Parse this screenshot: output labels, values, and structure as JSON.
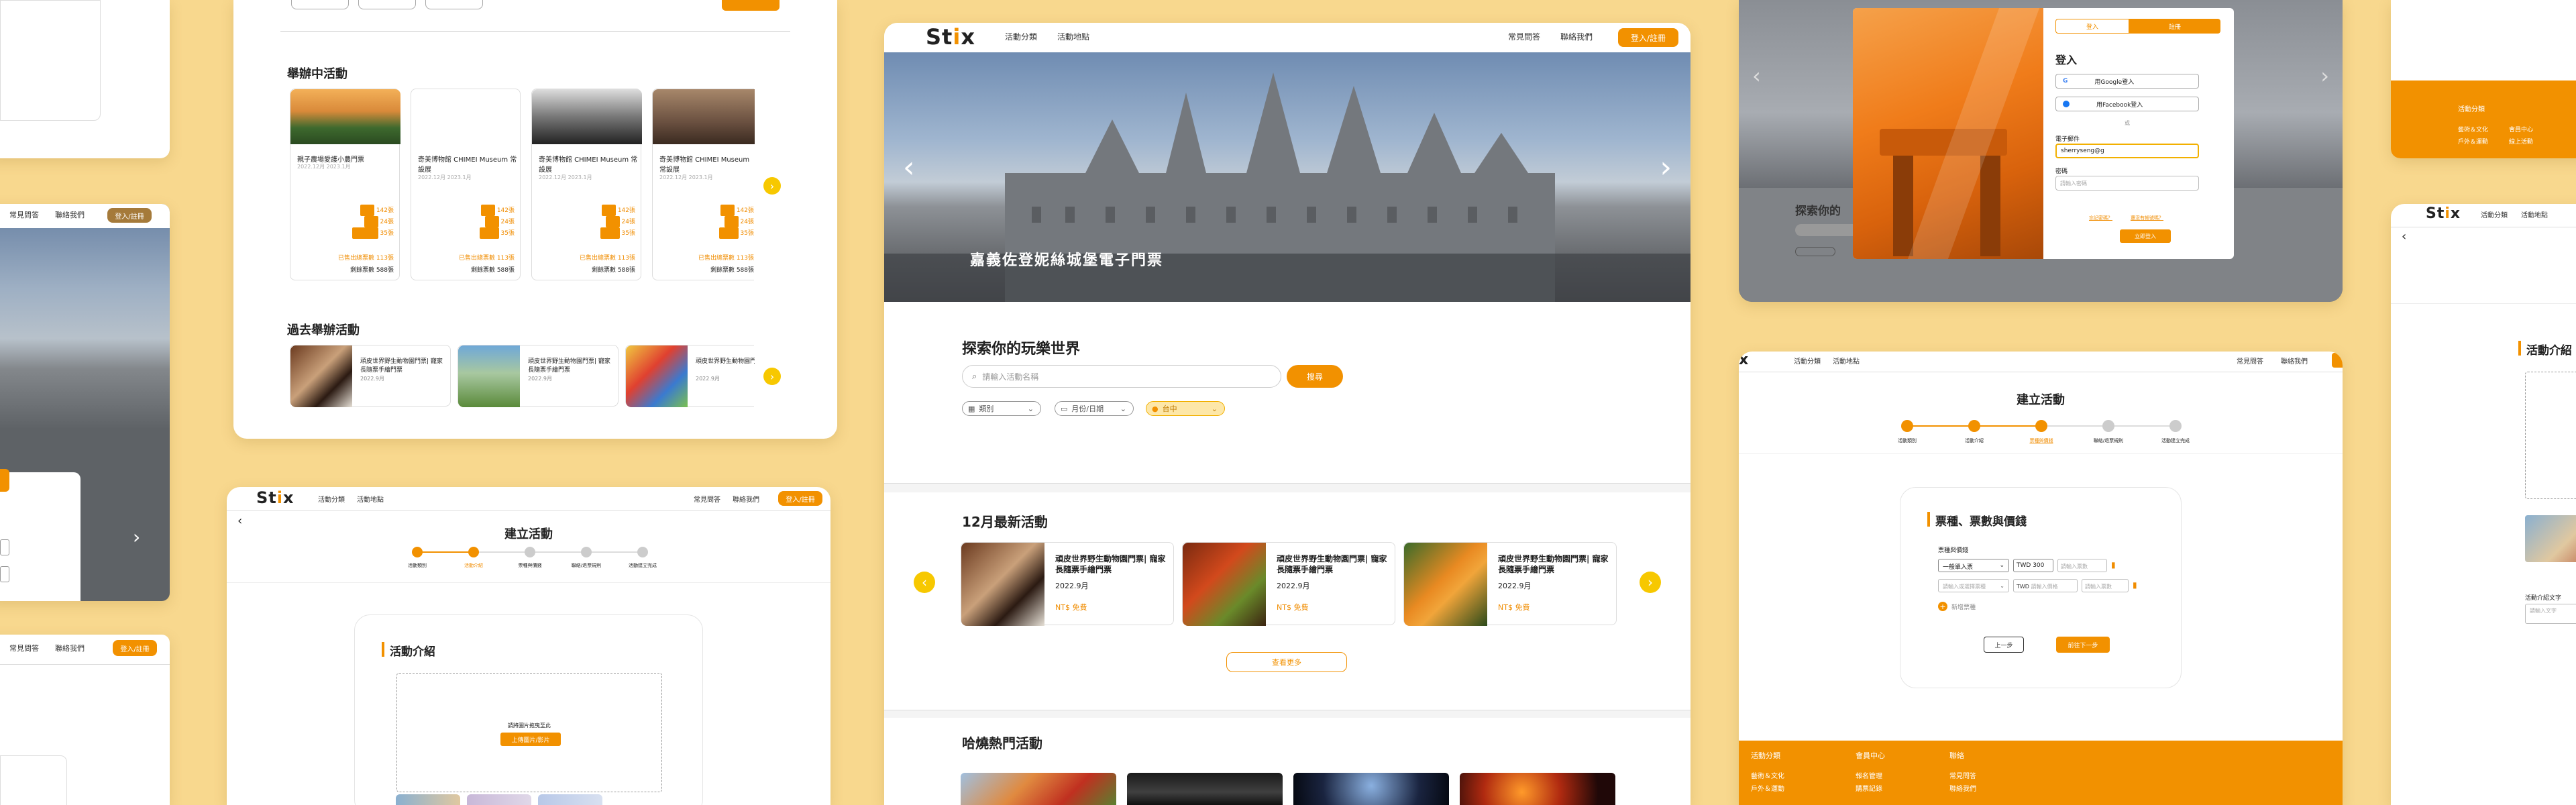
{
  "brand": {
    "logo_left": "St",
    "logo_mid": "i",
    "logo_right": "x",
    "accent": "#f29100",
    "bg": "#f8d88e"
  },
  "nav": {
    "categories": "活動分類",
    "locations": "活動地點",
    "faq": "常見問答",
    "contact": "聯絡我們",
    "login": "登入/註冊"
  },
  "main": {
    "hero_title": "嘉義佐登妮絲城堡電子門票",
    "search_heading": "探索你的玩樂世界",
    "search_placeholder": "請輸入活動名稱",
    "search_button": "搜尋",
    "filter_category": "類別",
    "filter_date": "月份/日期",
    "filter_location": "台中",
    "dec_heading": "12月最新活動",
    "dec_items": [
      {
        "title": "頑皮世界野生動物園門票| 寵家長隨票手繪門票",
        "date": "2022.9月",
        "price": "NT$ 免費"
      },
      {
        "title": "頑皮世界野生動物園門票| 寵家長隨票手繪門票",
        "date": "2022.9月",
        "price": "NT$ 免費"
      },
      {
        "title": "頑皮世界野生動物園門票| 寵家長隨票手繪門票",
        "date": "2022.9月",
        "price": "NT$ 免費"
      }
    ],
    "see_more": "查看更多",
    "hot_heading": "哈燒熱門活動"
  },
  "dashboard": {
    "ongoing_heading": "舉辦中活動",
    "ongoing": [
      {
        "title": "親子農場愛護小農門票",
        "date": "2022.12月 2023.1月",
        "sold": "已售出總票數 113張",
        "left": "剩餘票數 588張"
      },
      {
        "title": "奇美博物館 CHIMEI Museum 常設展",
        "date": "2022.12月 2023.1月",
        "sold": "已售出總票數 113張",
        "left": "剩餘票數 588張"
      },
      {
        "title": "奇美博物館 CHIMEI Museum 常設展",
        "date": "2022.12月 2023.1月",
        "sold": "已售出總票數 113張",
        "left": "剩餘票數 588張"
      },
      {
        "title": "奇美博物館 CHIMEI Museum 常設展",
        "date": "2022.12月 2023.1月",
        "sold": "已售出總票數 113張",
        "left": "剩餘票數 588張"
      }
    ],
    "ticket_counts": [
      "142張",
      "24張",
      "35張"
    ],
    "past_heading": "過去舉辦活動",
    "past": [
      {
        "title": "頑皮世界野生動物園門票| 寵家長隨票手繪門票",
        "date": "2022.9月"
      },
      {
        "title": "頑皮世界野生動物園門票| 寵家長隨票手繪門票",
        "date": "2022.9月"
      },
      {
        "title": "頑皮世界野生動物園門票| 寵家長隨票手繪門票",
        "date": "2022.9月"
      }
    ]
  },
  "create": {
    "heading": "建立活動",
    "steps": [
      "活動類別",
      "活動介紹",
      "票種與價錢",
      "聯絡/退票規則",
      "活動建立完成"
    ],
    "intro_heading": "活動介紹",
    "upload_hint": "請將圖片拖曳至此",
    "upload_button": "上傳圖片/影片"
  },
  "tickets": {
    "heading": "票種、票數與價錢",
    "row_label": "票種與價錢",
    "type1": "一般單入票",
    "currency": "TWD",
    "price1": "300",
    "qty_ph": "請輸入票數",
    "type2_ph": "請輸入或選擇票種",
    "price_ph": "請輸入價格",
    "add": "新增票種",
    "prev": "上一步",
    "next": "前往下一步"
  },
  "login": {
    "tab_login": "登入",
    "tab_register": "註冊",
    "heading": "登入",
    "google": "用Google登入",
    "facebook": "用Facebook登入",
    "or": "或",
    "email_label": "電子郵件",
    "email_value": "sherryseng@g",
    "password_label": "密碼",
    "password_ph": "請輸入密碼",
    "forgot": "忘記密碼？",
    "register_link": "還沒有帳號嗎？",
    "submit": "立即登入",
    "behind_heading": "探索你的"
  },
  "footer": {
    "col1_title": "活動分類",
    "col1_items": [
      "藝術＆文化",
      "戶外＆運動"
    ],
    "col2_title": "會員中心",
    "col2_items": [
      "報名管理",
      "購票記錄"
    ],
    "col3_title": "聯絡",
    "col3_items": [
      "常見問答",
      "聯絡我們"
    ]
  },
  "far_right": {
    "heading": "活動介紹",
    "footer_items": [
      "活動分類",
      "藝術＆文化",
      "戶外＆運動",
      "會員中心",
      "報名管理",
      "線上活動"
    ],
    "caption": "活動介紹文字",
    "caption_ph": "請輸入文字"
  }
}
